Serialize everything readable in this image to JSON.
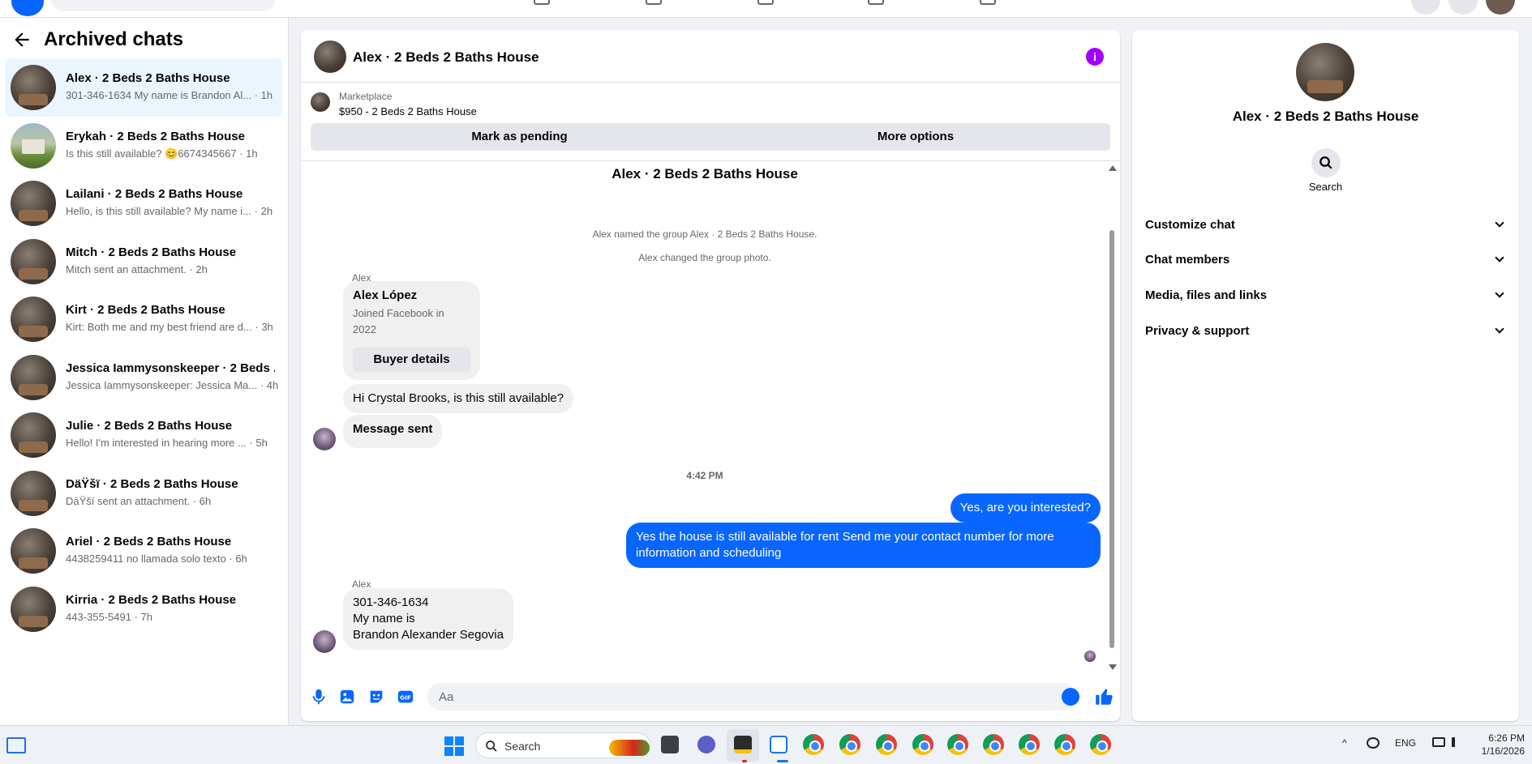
{
  "left_panel": {
    "title": "Archived chats",
    "chats": [
      {
        "name": "Alex · 2 Beds 2 Baths House",
        "preview": "301-346-1634 My name is Brandon Al... · 1h"
      },
      {
        "name": "Erykah · 2 Beds 2 Baths House",
        "preview": "Is this still available? 😊6674345667 · 1h"
      },
      {
        "name": "Lailani · 2 Beds 2 Baths House",
        "preview": "Hello, is this still available? My name i... · 2h"
      },
      {
        "name": "Mitch · 2 Beds 2 Baths House",
        "preview": "Mitch sent an attachment. · 2h"
      },
      {
        "name": "Kirt · 2 Beds 2 Baths House",
        "preview": "Kirt: Both me and my best friend are d... · 3h"
      },
      {
        "name": "Jessica Iammysonskeeper · 2 Beds ...",
        "preview": "Jessica Iammysonskeeper: Jessica Ma... · 4h"
      },
      {
        "name": "Julie · 2 Beds 2 Baths House",
        "preview": "Hello! I'm interested in hearing more ... · 5h"
      },
      {
        "name": "DäŸšï · 2 Beds 2 Baths House",
        "preview": "DäŸšï sent an attachment. · 6h"
      },
      {
        "name": "Ariel · 2 Beds 2 Baths House",
        "preview": "4438259411 no llamada solo texto · 6h"
      },
      {
        "name": "Kirria · 2 Beds 2 Baths House",
        "preview": "443-355-5491 · 7h"
      }
    ]
  },
  "conversation": {
    "title": "Alex · 2 Beds 2 Baths House",
    "marketplace_label": "Marketplace",
    "listing": "$950 - 2 Beds 2 Baths House",
    "mark_pending": "Mark as pending",
    "more_options": "More options",
    "group_title": "Alex · 2 Beds 2 Baths House",
    "system_1": "Alex named the group Alex · 2 Beds 2 Baths House.",
    "system_2": "Alex changed the group photo.",
    "sender_1": "Alex",
    "card_name": "Alex López",
    "card_sub": "Joined Facebook in 2022",
    "card_button": "Buyer details",
    "msg_1": "Hi Crystal Brooks, is this still available?",
    "msg_2": "Message sent",
    "time": "4:42 PM",
    "out_1": "Yes, are you interested?",
    "out_2": "Yes the house is still available for rent Send me your contact number for more information and  scheduling",
    "sender_2": "Alex",
    "reply_line_1": "301-346-1634",
    "reply_line_2": "My name is",
    "reply_line_3": "Brandon Alexander Segovia",
    "composer_placeholder": "Aa"
  },
  "right_panel": {
    "name": "Alex · 2 Beds 2 Baths House",
    "search_label": "Search",
    "sections": [
      "Customize chat",
      "Chat members",
      "Media, files and links",
      "Privacy & support"
    ]
  },
  "taskbar": {
    "search_label": "Search",
    "language": "ENG",
    "time": "6:26 PM",
    "date": "1/16/2026"
  },
  "colors": {
    "accent": "#0866ff",
    "info": "#a100ff"
  }
}
